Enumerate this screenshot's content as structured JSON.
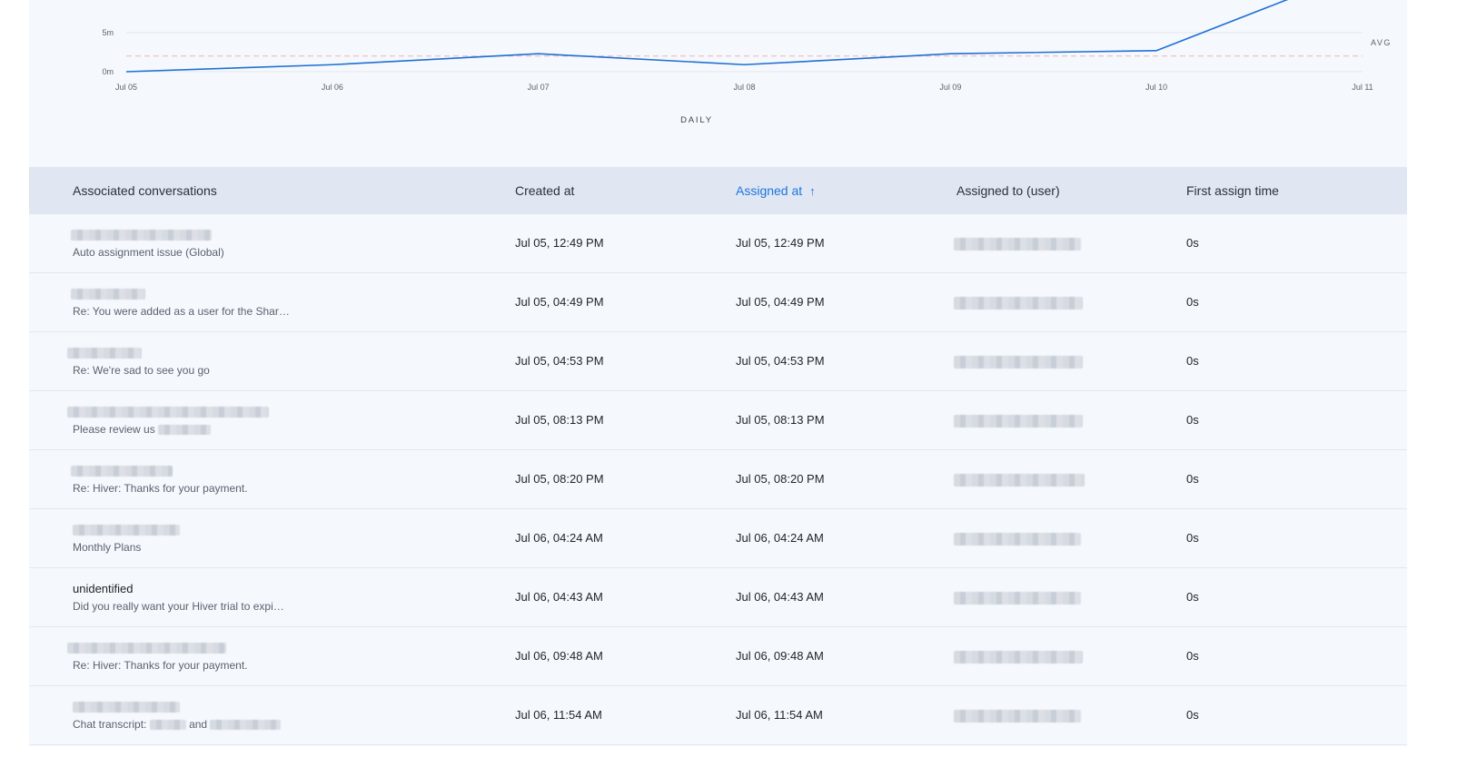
{
  "chart_data": {
    "type": "line",
    "x": [
      "Jul 05",
      "Jul 06",
      "Jul 07",
      "Jul 08",
      "Jul 09",
      "Jul 10",
      "Jul 11"
    ],
    "y_ticks": [
      "0m",
      "5m"
    ],
    "avg_label": "AVG",
    "xlabel": "DAILY",
    "series": [
      {
        "values": [
          0,
          0.9,
          2.3,
          0.9,
          2.3,
          2.7,
          13
        ]
      }
    ],
    "avg_value": 2.0,
    "ylim": [
      0,
      9
    ]
  },
  "colors": {
    "line": "#1f6fd6",
    "avg": "#f0b4b4",
    "active_header": "#1f74e0"
  },
  "table": {
    "headers": {
      "conversations": "Associated conversations",
      "created": "Created at",
      "assigned": "Assigned at",
      "user": "Assigned to (user)",
      "first_assign": "First assign time"
    },
    "sort_icon": "arrow-up-icon",
    "rows": [
      {
        "subject": "Auto assignment issue (Global)",
        "created": "Jul 05, 12:49 PM",
        "assigned": "Jul 05, 12:49 PM",
        "first_assign": "0s"
      },
      {
        "subject": "Re: You were added as a user for the Shar…",
        "created": "Jul 05, 04:49 PM",
        "assigned": "Jul 05, 04:49 PM",
        "first_assign": "0s"
      },
      {
        "subject": "Re: We're sad to see you go",
        "created": "Jul 05, 04:53 PM",
        "assigned": "Jul 05, 04:53 PM",
        "first_assign": "0s"
      },
      {
        "subject": "Please review us",
        "created": "Jul 05, 08:13 PM",
        "assigned": "Jul 05, 08:13 PM",
        "first_assign": "0s"
      },
      {
        "subject": "Re: Hiver: Thanks for your payment.",
        "created": "Jul 05, 08:20 PM",
        "assigned": "Jul 05, 08:20 PM",
        "first_assign": "0s"
      },
      {
        "subject": "Monthly Plans",
        "created": "Jul 06, 04:24 AM",
        "assigned": "Jul 06, 04:24 AM",
        "first_assign": "0s"
      },
      {
        "sender": "unidentified",
        "subject": "Did you really want your Hiver trial to expi…",
        "created": "Jul 06, 04:43 AM",
        "assigned": "Jul 06, 04:43 AM",
        "first_assign": "0s"
      },
      {
        "subject": "Re: Hiver: Thanks for your payment.",
        "created": "Jul 06, 09:48 AM",
        "assigned": "Jul 06, 09:48 AM",
        "first_assign": "0s"
      },
      {
        "subject": "Chat transcript:",
        "subject_mid": "and",
        "created": "Jul 06, 11:54 AM",
        "assigned": "Jul 06, 11:54 AM",
        "first_assign": "0s"
      }
    ]
  }
}
